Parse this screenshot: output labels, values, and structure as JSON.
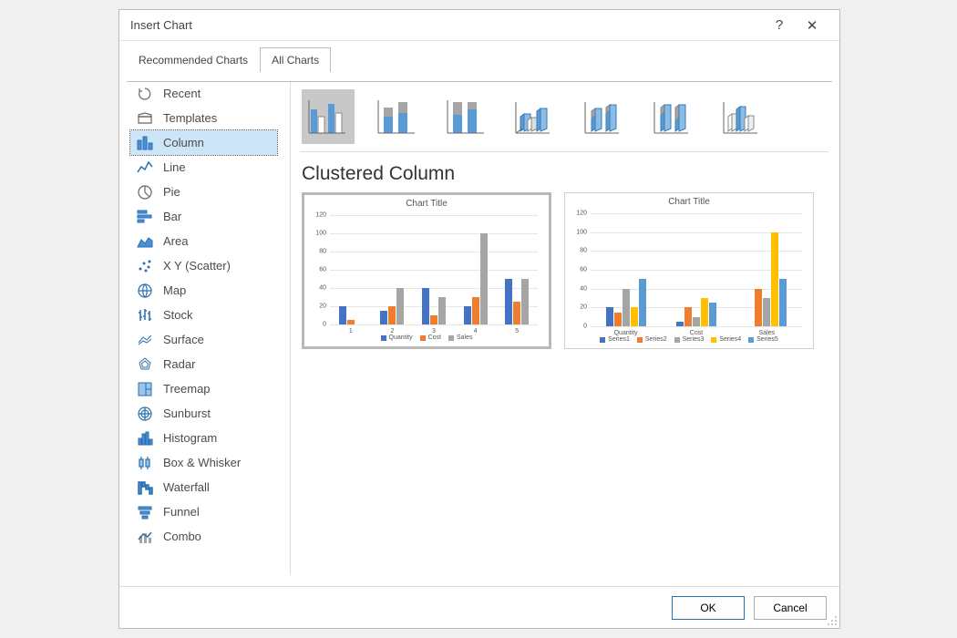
{
  "dialog": {
    "title": "Insert Chart",
    "help_icon": "?",
    "close_icon": "✕"
  },
  "tabs": {
    "recommended": "Recommended Charts",
    "all": "All Charts",
    "active": "all"
  },
  "categories": [
    {
      "id": "recent",
      "label": "Recent"
    },
    {
      "id": "templates",
      "label": "Templates"
    },
    {
      "id": "column",
      "label": "Column",
      "selected": true
    },
    {
      "id": "line",
      "label": "Line"
    },
    {
      "id": "pie",
      "label": "Pie"
    },
    {
      "id": "bar",
      "label": "Bar"
    },
    {
      "id": "area",
      "label": "Area"
    },
    {
      "id": "scatter",
      "label": "X Y (Scatter)"
    },
    {
      "id": "map",
      "label": "Map"
    },
    {
      "id": "stock",
      "label": "Stock"
    },
    {
      "id": "surface",
      "label": "Surface"
    },
    {
      "id": "radar",
      "label": "Radar"
    },
    {
      "id": "treemap",
      "label": "Treemap"
    },
    {
      "id": "sunburst",
      "label": "Sunburst"
    },
    {
      "id": "histogram",
      "label": "Histogram"
    },
    {
      "id": "boxwhisker",
      "label": "Box & Whisker"
    },
    {
      "id": "waterfall",
      "label": "Waterfall"
    },
    {
      "id": "funnel",
      "label": "Funnel"
    },
    {
      "id": "combo",
      "label": "Combo"
    }
  ],
  "subtype_name": "Clustered Column",
  "subtypes": [
    {
      "id": "clustered-column",
      "selected": true
    },
    {
      "id": "stacked-column"
    },
    {
      "id": "stacked100-column"
    },
    {
      "id": "clustered-column-3d"
    },
    {
      "id": "stacked-column-3d"
    },
    {
      "id": "stacked100-column-3d"
    },
    {
      "id": "column-3d"
    }
  ],
  "buttons": {
    "ok": "OK",
    "cancel": "Cancel"
  },
  "colors": {
    "blue": "#4472c4",
    "orange": "#ed7d31",
    "gray": "#a5a5a5",
    "yellow": "#ffc000",
    "blue2": "#5b9bd5"
  },
  "chart_data": [
    {
      "type": "bar",
      "title": "Chart Title",
      "ylim": [
        0,
        120
      ],
      "yticks": [
        0,
        20,
        40,
        60,
        80,
        100,
        120
      ],
      "categories": [
        "1",
        "2",
        "3",
        "4",
        "5"
      ],
      "series": [
        {
          "name": "Quantity",
          "color": "blue",
          "values": [
            20,
            15,
            40,
            20,
            50
          ]
        },
        {
          "name": "Cost",
          "color": "orange",
          "values": [
            5,
            20,
            10,
            30,
            25
          ]
        },
        {
          "name": "Sales",
          "color": "gray",
          "values": [
            0,
            40,
            30,
            100,
            50
          ]
        }
      ],
      "selected": true
    },
    {
      "type": "bar",
      "title": "Chart Title",
      "ylim": [
        0,
        120
      ],
      "yticks": [
        0,
        20,
        40,
        60,
        80,
        100,
        120
      ],
      "categories": [
        "Quantity",
        "Cost",
        "Sales"
      ],
      "series": [
        {
          "name": "Series1",
          "color": "blue",
          "values": [
            20,
            5,
            0
          ]
        },
        {
          "name": "Series2",
          "color": "orange",
          "values": [
            15,
            20,
            40
          ]
        },
        {
          "name": "Series3",
          "color": "gray",
          "values": [
            40,
            10,
            30
          ]
        },
        {
          "name": "Series4",
          "color": "yellow",
          "values": [
            20,
            30,
            100
          ]
        },
        {
          "name": "Series5",
          "color": "blue2",
          "values": [
            50,
            25,
            50
          ]
        }
      ]
    }
  ]
}
